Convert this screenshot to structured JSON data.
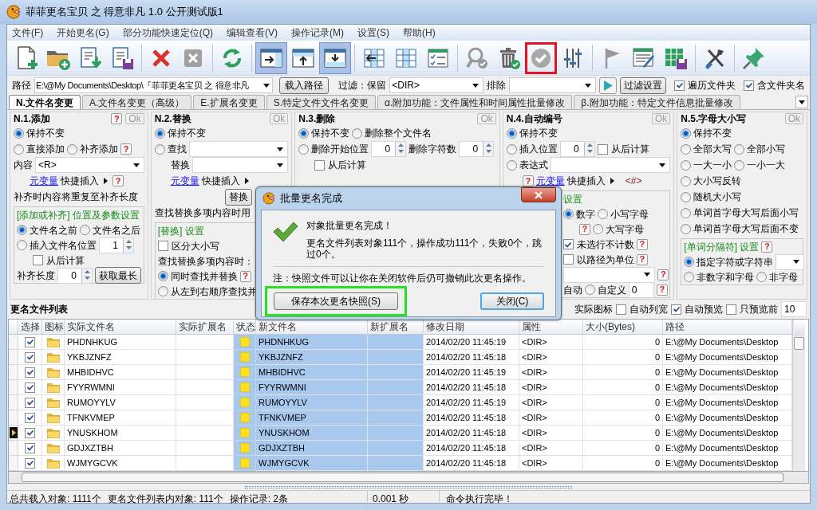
{
  "window": {
    "title": "菲菲更名宝贝 之 得意非凡 1.0 公开测试版1"
  },
  "menu": [
    "文件(F)",
    "开始更名(G)",
    "部分功能快速定位(Q)",
    "编辑查看(V)",
    "操作记录(M)",
    "设置(S)",
    "帮助(H)"
  ],
  "toolbar_groups": [
    [
      {
        "kind": "new-file",
        "pressed": false,
        "highlighted": false
      },
      {
        "kind": "folder-add",
        "pressed": false,
        "highlighted": false
      },
      {
        "kind": "document-download",
        "pressed": false,
        "highlighted": false
      },
      {
        "kind": "document-save",
        "pressed": false,
        "highlighted": false
      }
    ],
    [
      {
        "kind": "delete",
        "pressed": false,
        "highlighted": false
      },
      {
        "kind": "cancel",
        "pressed": false,
        "highlighted": false
      }
    ],
    [
      {
        "kind": "refresh",
        "pressed": false,
        "highlighted": false
      }
    ],
    [
      {
        "kind": "window-arrow-right",
        "pressed": true,
        "highlighted": false
      },
      {
        "kind": "window-arrow-up",
        "pressed": false,
        "highlighted": false
      },
      {
        "kind": "window-arrow-down",
        "pressed": true,
        "highlighted": false
      }
    ],
    [
      {
        "kind": "table-arrow",
        "pressed": false,
        "highlighted": false
      },
      {
        "kind": "table-columns",
        "pressed": false,
        "highlighted": false
      },
      {
        "kind": "checklist",
        "pressed": false,
        "highlighted": false
      }
    ],
    [
      {
        "kind": "magnifier-check",
        "pressed": false,
        "highlighted": false
      },
      {
        "kind": "trash-check",
        "pressed": false,
        "highlighted": false
      },
      {
        "kind": "check-circle",
        "pressed": false,
        "highlighted": true
      },
      {
        "kind": "sliders",
        "pressed": false,
        "highlighted": false
      }
    ],
    [
      {
        "kind": "flag",
        "pressed": false,
        "highlighted": false
      },
      {
        "kind": "table-pencil",
        "pressed": false,
        "highlighted": false
      },
      {
        "kind": "table-save",
        "pressed": false,
        "highlighted": false
      }
    ],
    [
      {
        "kind": "tools",
        "pressed": false,
        "highlighted": false
      }
    ],
    [
      {
        "kind": "pin",
        "pressed": false,
        "highlighted": false
      }
    ]
  ],
  "path_bar": {
    "label": "路径",
    "path": "E:\\@My Documents\\Desktop\\『菲菲更名宝贝 之 得意非凡",
    "load_button": "载入路径",
    "filter_label": "过滤：保留",
    "keep": "<DIR>",
    "exclude_label": "排除",
    "settings_button": "过滤设置",
    "options": [
      {
        "label": "遍历文件夹",
        "checked": true
      },
      {
        "label": "含文件夹名",
        "checked": true
      }
    ]
  },
  "tabs": [
    {
      "label": "N.文件名变更",
      "selected": true
    },
    {
      "label": "A.文件名变更（高级）",
      "selected": false
    },
    {
      "label": "E.扩展名变更",
      "selected": false
    },
    {
      "label": "S.特定文件文件名变更",
      "selected": false
    },
    {
      "label": "α.附加功能：文件属性和时间属性批量修改",
      "selected": false
    },
    {
      "label": "β.附加功能：特定文件信息批量修改",
      "selected": false
    }
  ],
  "panels": [
    {
      "title": "N.1.添加",
      "header": [
        {
          "kind": "help",
          "text": "?"
        },
        {
          "kind": "ok",
          "text": "Ok"
        }
      ],
      "sections": [
        {
          "kind": "plain",
          "rows": [
            {
              "kind": "row",
              "items": [
                {
                  "kind": "radio",
                  "label": "保持不变",
                  "selected": true
                }
              ]
            },
            {
              "kind": "row",
              "items": [
                {
                  "kind": "radio",
                  "label": "直接添加",
                  "selected": false
                },
                {
                  "kind": "radio",
                  "label": "补齐添加",
                  "selected": false
                },
                {
                  "kind": "help",
                  "text": "?"
                }
              ]
            },
            {
              "kind": "row",
              "items": [
                {
                  "kind": "text",
                  "text": "内容"
                },
                {
                  "kind": "combo",
                  "value": "<R>"
                }
              ]
            },
            {
              "kind": "sub",
              "items": [
                {
                  "kind": "link",
                  "text": "元变量"
                },
                {
                  "kind": "text",
                  "text": "快捷插入"
                },
                {
                  "kind": "arrow"
                },
                {
                  "kind": "help",
                  "text": "?"
                }
              ]
            },
            {
              "kind": "row",
              "items": [
                {
                  "kind": "text",
                  "text": "补齐时内容将重复至补齐长度"
                }
              ]
            }
          ]
        },
        {
          "kind": "box",
          "rows": [
            {
              "kind": "row",
              "items": [
                {
                  "kind": "heading",
                  "text": "[添加或补齐] 位置及参数设置"
                }
              ]
            },
            {
              "kind": "row",
              "items": [
                {
                  "kind": "radio",
                  "label": "文件名之前",
                  "selected": true
                },
                {
                  "kind": "radio",
                  "label": "文件名之后",
                  "selected": false
                }
              ]
            },
            {
              "kind": "row",
              "items": [
                {
                  "kind": "radio",
                  "label": "插入文件名位置",
                  "selected": false
                },
                {
                  "kind": "spin",
                  "value": "1"
                }
              ]
            },
            {
              "kind": "sub",
              "items": [
                {
                  "kind": "checkbox",
                  "label": "从后计算",
                  "checked": false
                }
              ]
            },
            {
              "kind": "row",
              "items": [
                {
                  "kind": "text",
                  "text": "补齐长度"
                },
                {
                  "kind": "spin",
                  "value": "0"
                },
                {
                  "kind": "button",
                  "text": "获取最长"
                }
              ]
            }
          ]
        }
      ]
    },
    {
      "title": "N.2.替换",
      "header": [
        {
          "kind": "ok",
          "text": "Ok"
        }
      ],
      "sections": [
        {
          "kind": "plain",
          "rows": [
            {
              "kind": "row",
              "items": [
                {
                  "kind": "radio",
                  "label": "保持不变",
                  "selected": true
                }
              ]
            },
            {
              "kind": "row",
              "items": [
                {
                  "kind": "radio",
                  "label": "查找",
                  "selected": false
                },
                {
                  "kind": "combo"
                }
              ]
            },
            {
              "kind": "sub",
              "items": [
                {
                  "kind": "text",
                  "text": "替换"
                },
                {
                  "kind": "combo"
                }
              ]
            },
            {
              "kind": "sub",
              "items": [
                {
                  "kind": "link",
                  "text": "元变量"
                },
                {
                  "kind": "text",
                  "text": "快捷插入"
                },
                {
                  "kind": "arrow"
                }
              ]
            },
            {
              "kind": "mid",
              "items": [
                {
                  "kind": "button",
                  "text": "替换"
                }
              ]
            },
            {
              "kind": "row",
              "items": [
                {
                  "kind": "text",
                  "text": "查找替换多项内容时用"
                }
              ]
            }
          ]
        },
        {
          "kind": "box",
          "rows": [
            {
              "kind": "row",
              "items": [
                {
                  "kind": "heading",
                  "text": "[替换] 设置"
                }
              ]
            },
            {
              "kind": "row",
              "items": [
                {
                  "kind": "checkbox",
                  "label": "区分大小写",
                  "checked": false
                }
              ]
            },
            {
              "kind": "row",
              "items": [
                {
                  "kind": "text",
                  "text": "查找替换多项内容时："
                }
              ]
            },
            {
              "kind": "row",
              "items": [
                {
                  "kind": "radio",
                  "label": "同时查找并替换",
                  "selected": true
                },
                {
                  "kind": "help",
                  "text": "?"
                }
              ]
            },
            {
              "kind": "row",
              "items": [
                {
                  "kind": "radio",
                  "label": "从左到右顺序查找并",
                  "selected": false
                }
              ]
            }
          ]
        }
      ]
    },
    {
      "title": "N.3.删除",
      "header": [
        {
          "kind": "ok",
          "text": "Ok"
        }
      ],
      "sections": [
        {
          "kind": "plain",
          "rows": [
            {
              "kind": "row",
              "items": [
                {
                  "kind": "radio",
                  "label": "保持不变",
                  "selected": true
                },
                {
                  "kind": "radio",
                  "label": "删除整个文件名",
                  "selected": false
                }
              ]
            },
            {
              "kind": "row",
              "items": [
                {
                  "kind": "radio",
                  "label": "删除开始位置",
                  "selected": false
                },
                {
                  "kind": "spin",
                  "value": "0"
                },
                {
                  "kind": "text",
                  "text": "删除字符数"
                },
                {
                  "kind": "spin",
                  "value": "0"
                }
              ]
            },
            {
              "kind": "sub",
              "items": [
                {
                  "kind": "checkbox",
                  "label": "从后计算",
                  "checked": false
                }
              ]
            }
          ]
        }
      ]
    },
    {
      "title": "N.4.自动编号",
      "header": [
        {
          "kind": "ok",
          "text": "Ok"
        }
      ],
      "sections": [
        {
          "kind": "plain",
          "rows": [
            {
              "kind": "row",
              "items": [
                {
                  "kind": "radio",
                  "label": "保持不变",
                  "selected": true
                }
              ]
            },
            {
              "kind": "row",
              "items": [
                {
                  "kind": "radio",
                  "label": "插入位置",
                  "selected": false
                },
                {
                  "kind": "spin",
                  "value": "0"
                },
                {
                  "kind": "checkbox",
                  "label": "从后计算",
                  "checked": false
                }
              ]
            },
            {
              "kind": "row",
              "items": [
                {
                  "kind": "radio",
                  "label": "表达式",
                  "selected": false
                },
                {
                  "kind": "combo"
                }
              ]
            },
            {
              "kind": "sub",
              "items": [
                {
                  "kind": "help",
                  "text": "?"
                },
                {
                  "kind": "link",
                  "text": "元变量"
                },
                {
                  "kind": "text",
                  "text": "快捷插入"
                },
                {
                  "kind": "arrow"
                },
                {
                  "kind": "token",
                  "text": "<#>"
                }
              ]
            }
          ]
        },
        {
          "kind": "covered",
          "rows": [
            {
              "kind": "row",
              "items": [
                {
                  "kind": "heading",
                  "text": "设置"
                }
              ]
            },
            {
              "kind": "row",
              "items": [
                {
                  "kind": "radio",
                  "label": "数字",
                  "selected": true
                },
                {
                  "kind": "radio",
                  "label": "小写字母",
                  "selected": false
                }
              ]
            },
            {
              "kind": "sub",
              "items": [
                {
                  "kind": "help",
                  "text": "?"
                },
                {
                  "kind": "radio",
                  "label": "大写字母",
                  "selected": false
                }
              ]
            },
            {
              "kind": "row",
              "items": [
                {
                  "kind": "checkbox",
                  "label": "未选行不计数",
                  "checked": true
                },
                {
                  "kind": "help",
                  "text": "?"
                }
              ]
            },
            {
              "kind": "row",
              "items": [
                {
                  "kind": "checkbox",
                  "label": "以路径为单位",
                  "checked": false
                },
                {
                  "kind": "help",
                  "text": "?"
                }
              ]
            },
            {
              "kind": "row",
              "items": [
                {
                  "kind": "combo"
                },
                {
                  "kind": "help",
                  "text": "?"
                }
              ]
            },
            {
              "kind": "row",
              "items": [
                {
                  "kind": "text",
                  "text": "自动"
                },
                {
                  "kind": "radio",
                  "label": "自定义",
                  "selected": false
                },
                {
                  "kind": "field",
                  "value": "0"
                },
                {
                  "kind": "help",
                  "text": "?"
                }
              ]
            }
          ]
        }
      ]
    },
    {
      "title": "N.5.字母大小写",
      "header": [
        {
          "kind": "ok",
          "text": "Ok"
        }
      ],
      "sections": [
        {
          "kind": "plain",
          "rows": [
            {
              "kind": "row",
              "items": [
                {
                  "kind": "radio",
                  "label": "保持不变",
                  "selected": true
                }
              ]
            },
            {
              "kind": "row",
              "items": [
                {
                  "kind": "radio",
                  "label": "全部大写",
                  "selected": false
                },
                {
                  "kind": "radio",
                  "label": "全部小写",
                  "selected": false
                }
              ]
            },
            {
              "kind": "row",
              "items": [
                {
                  "kind": "radio",
                  "label": "一大一小",
                  "selected": false
                },
                {
                  "kind": "radio",
                  "label": "一小一大",
                  "selected": false
                }
              ]
            },
            {
              "kind": "row",
              "items": [
                {
                  "kind": "radio",
                  "label": "大小写反转",
                  "selected": false
                }
              ]
            },
            {
              "kind": "row",
              "items": [
                {
                  "kind": "radio",
                  "label": "随机大小写",
                  "selected": false
                }
              ]
            },
            {
              "kind": "row",
              "items": [
                {
                  "kind": "radio",
                  "label": "单词首字母大写后面小写",
                  "selected": false
                }
              ]
            },
            {
              "kind": "row",
              "items": [
                {
                  "kind": "radio",
                  "label": "单词首字母大写后面不变",
                  "selected": false
                }
              ]
            }
          ]
        },
        {
          "kind": "box",
          "rows": [
            {
              "kind": "row",
              "items": [
                {
                  "kind": "heading",
                  "text": "[单词分隔符] 设置"
                },
                {
                  "kind": "help",
                  "text": "?"
                }
              ]
            },
            {
              "kind": "row",
              "items": [
                {
                  "kind": "radio",
                  "label": "指定字符或字符串",
                  "selected": true
                },
                {
                  "kind": "combo"
                }
              ]
            },
            {
              "kind": "row",
              "items": [
                {
                  "kind": "radio",
                  "label": "非数字和字母",
                  "selected": false
                },
                {
                  "kind": "radio",
                  "label": "非字母",
                  "selected": false
                }
              ]
            }
          ]
        }
      ]
    }
  ],
  "dialog": {
    "title": "批量更名完成",
    "heading": "对象批量更名完成！",
    "message": "更名文件列表对象111个，操作成功111个，失败0个，跳过0个。",
    "note": "注：快照文件可以让你在关闭软件后仍可撤销此次更名操作。",
    "buttons": [
      {
        "label": "保存本次更名快照(S)",
        "default": false,
        "highlighted": true
      },
      {
        "label": "关闭(C)",
        "default": true,
        "highlighted": false
      }
    ]
  },
  "file_list": {
    "title": "更名文件列表",
    "options": [
      {
        "kind": "text",
        "text": "实际图标"
      },
      {
        "kind": "checkbox",
        "label": "自动列宽",
        "checked": false
      },
      {
        "kind": "checkbox",
        "label": "自动预览",
        "checked": true
      },
      {
        "kind": "checkbox",
        "label": "只预览前",
        "checked": false
      },
      {
        "kind": "field",
        "value": "10"
      }
    ],
    "columns": [
      "选择",
      "图标",
      "实际文件名",
      "实际扩展名",
      "状态",
      "新文件名",
      "新扩展名",
      "修改日期",
      "属性",
      "大小(Bytes)",
      "路径"
    ],
    "rows": [
      {
        "checked": true,
        "current": false,
        "name": "PHDNHKUG",
        "new_name": "PHDNHKUG",
        "modified": "2014/02/20 11:45:19",
        "attributes": "<DIR>",
        "size": "0",
        "path": "E:\\@My Documents\\Desktop"
      },
      {
        "checked": true,
        "current": false,
        "name": "YKBJZNFZ",
        "new_name": "YKBJZNFZ",
        "modified": "2014/02/20 11:45:18",
        "attributes": "<DIR>",
        "size": "0",
        "path": "E:\\@My Documents\\Desktop"
      },
      {
        "checked": true,
        "current": false,
        "name": "MHBIDHVC",
        "new_name": "MHBIDHVC",
        "modified": "2014/02/20 11:45:19",
        "attributes": "<DIR>",
        "size": "0",
        "path": "E:\\@My Documents\\Desktop"
      },
      {
        "checked": true,
        "current": false,
        "name": "FYYRWMNI",
        "new_name": "FYYRWMNI",
        "modified": "2014/02/20 11:45:18",
        "attributes": "<DIR>",
        "size": "0",
        "path": "E:\\@My Documents\\Desktop"
      },
      {
        "checked": true,
        "current": false,
        "name": "RUMOYYLV",
        "new_name": "RUMOYYLV",
        "modified": "2014/02/20 11:45:19",
        "attributes": "<DIR>",
        "size": "0",
        "path": "E:\\@My Documents\\Desktop"
      },
      {
        "checked": true,
        "current": false,
        "name": "TFNKVMEP",
        "new_name": "TFNKVMEP",
        "modified": "2014/02/20 11:45:18",
        "attributes": "<DIR>",
        "size": "0",
        "path": "E:\\@My Documents\\Desktop"
      },
      {
        "checked": true,
        "current": true,
        "name": "YNUSKHOM",
        "new_name": "YNUSKHOM",
        "modified": "2014/02/20 11:45:18",
        "attributes": "<DIR>",
        "size": "0",
        "path": "E:\\@My Documents\\Desktop"
      },
      {
        "checked": true,
        "current": false,
        "name": "GDJXZTBH",
        "new_name": "GDJXZTBH",
        "modified": "2014/02/20 11:45:18",
        "attributes": "<DIR>",
        "size": "0",
        "path": "E:\\@My Documents\\Desktop"
      },
      {
        "checked": true,
        "current": false,
        "name": "WJMYGCVK",
        "new_name": "WJMYGCVK",
        "modified": "2014/02/20 11:45:18",
        "attributes": "<DIR>",
        "size": "0",
        "path": "E:\\@My Documents\\Desktop"
      }
    ]
  },
  "status_bar": [
    "总共载入对象: 1111个",
    "更名文件列表内对象: 111个",
    "操作记录: 2条",
    "0.001 秒",
    "命令执行完毕！"
  ]
}
